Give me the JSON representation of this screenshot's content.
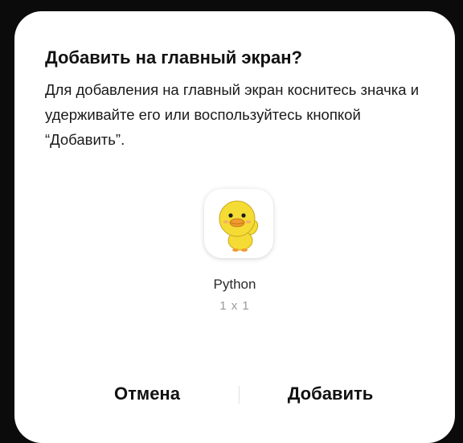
{
  "dialog": {
    "title": "Добавить на главный экран?",
    "message": "Для добавления на главный экран коснитесь значка и удерживайте его или воспользуйтесь кнопкой “Добавить”.",
    "app": {
      "icon": "duck-icon",
      "name": "Python",
      "size": "1 x 1"
    },
    "buttons": {
      "cancel_label": "Отмена",
      "add_label": "Добавить"
    }
  },
  "colors": {
    "backdrop": "#0b0b0b",
    "dialog_bg": "#ffffff",
    "duck_yellow": "#f5dc35",
    "text_primary": "#111111",
    "text_secondary": "#9a9a9a"
  }
}
